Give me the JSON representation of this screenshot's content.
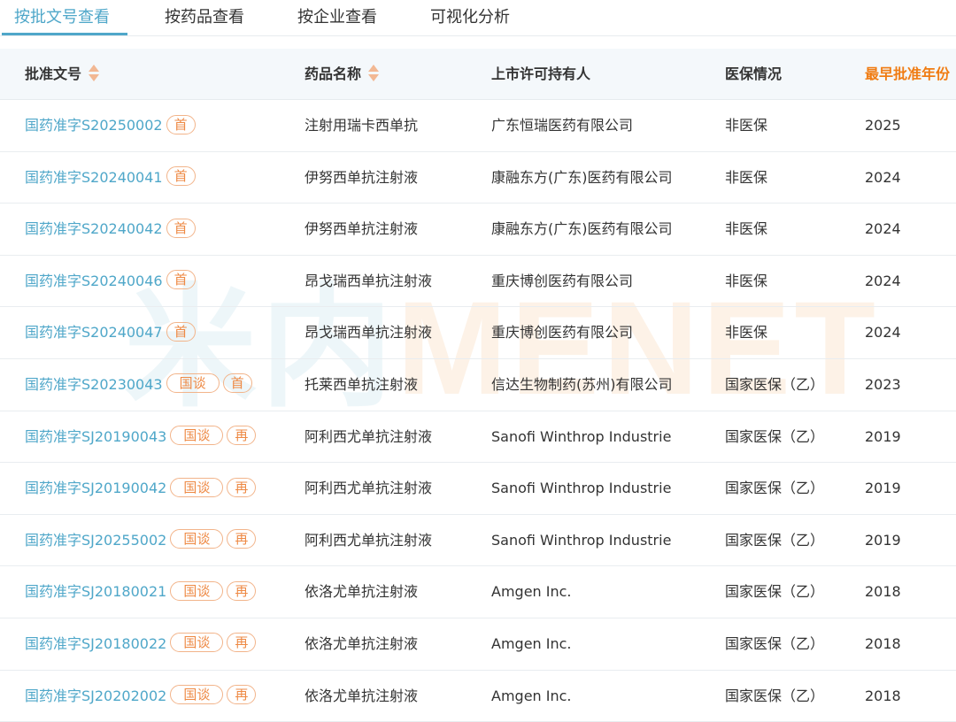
{
  "tabs": [
    {
      "label": "按批文号查看",
      "active": true
    },
    {
      "label": "按药品查看",
      "active": false
    },
    {
      "label": "按企业查看",
      "active": false
    },
    {
      "label": "可视化分析",
      "active": false
    }
  ],
  "table": {
    "headers": {
      "approval_no": "批准文号",
      "drug_name": "药品名称",
      "holder": "上市许可持有人",
      "insurance": "医保情况",
      "earliest_year": "最早批准年份"
    },
    "rows": [
      {
        "approval_no": "国药准字S20250002",
        "tags": [
          "首"
        ],
        "drug_name": "注射用瑞卡西单抗",
        "holder": "广东恒瑞医药有限公司",
        "insurance": "非医保",
        "year": "2025"
      },
      {
        "approval_no": "国药准字S20240041",
        "tags": [
          "首"
        ],
        "drug_name": "伊努西单抗注射液",
        "holder": "康融东方(广东)医药有限公司",
        "insurance": "非医保",
        "year": "2024"
      },
      {
        "approval_no": "国药准字S20240042",
        "tags": [
          "首"
        ],
        "drug_name": "伊努西单抗注射液",
        "holder": "康融东方(广东)医药有限公司",
        "insurance": "非医保",
        "year": "2024"
      },
      {
        "approval_no": "国药准字S20240046",
        "tags": [
          "首"
        ],
        "drug_name": "昂戈瑞西单抗注射液",
        "holder": "重庆博创医药有限公司",
        "insurance": "非医保",
        "year": "2024"
      },
      {
        "approval_no": "国药准字S20240047",
        "tags": [
          "首"
        ],
        "drug_name": "昂戈瑞西单抗注射液",
        "holder": "重庆博创医药有限公司",
        "insurance": "非医保",
        "year": "2024"
      },
      {
        "approval_no": "国药准字S20230043",
        "tags": [
          "国谈",
          "首"
        ],
        "drug_name": "托莱西单抗注射液",
        "holder": "信达生物制药(苏州)有限公司",
        "insurance": "国家医保（乙）",
        "year": "2023"
      },
      {
        "approval_no": "国药准字SJ20190043",
        "tags": [
          "国谈",
          "再"
        ],
        "drug_name": "阿利西尤单抗注射液",
        "holder": "Sanofi Winthrop Industrie",
        "insurance": "国家医保（乙）",
        "year": "2019"
      },
      {
        "approval_no": "国药准字SJ20190042",
        "tags": [
          "国谈",
          "再"
        ],
        "drug_name": "阿利西尤单抗注射液",
        "holder": "Sanofi Winthrop Industrie",
        "insurance": "国家医保（乙）",
        "year": "2019"
      },
      {
        "approval_no": "国药准字SJ20255002",
        "tags": [
          "国谈",
          "再"
        ],
        "drug_name": "阿利西尤单抗注射液",
        "holder": "Sanofi Winthrop Industrie",
        "insurance": "国家医保（乙）",
        "year": "2019"
      },
      {
        "approval_no": "国药准字SJ20180021",
        "tags": [
          "国谈",
          "再"
        ],
        "drug_name": "依洛尤单抗注射液",
        "holder": "Amgen Inc.",
        "insurance": "国家医保（乙）",
        "year": "2018"
      },
      {
        "approval_no": "国药准字SJ20180022",
        "tags": [
          "国谈",
          "再"
        ],
        "drug_name": "依洛尤单抗注射液",
        "holder": "Amgen Inc.",
        "insurance": "国家医保（乙）",
        "year": "2018"
      },
      {
        "approval_no": "国药准字SJ20202002",
        "tags": [
          "国谈",
          "再"
        ],
        "drug_name": "依洛尤单抗注射液",
        "holder": "Amgen Inc.",
        "insurance": "国家医保（乙）",
        "year": "2018"
      }
    ]
  },
  "watermark": {
    "part1": "米内",
    "part2": "MENET"
  },
  "colors": {
    "accent": "#4fa7c9",
    "highlight": "#f07c13",
    "tag": "#ee8a45",
    "header_bg": "#f4f8fb"
  }
}
